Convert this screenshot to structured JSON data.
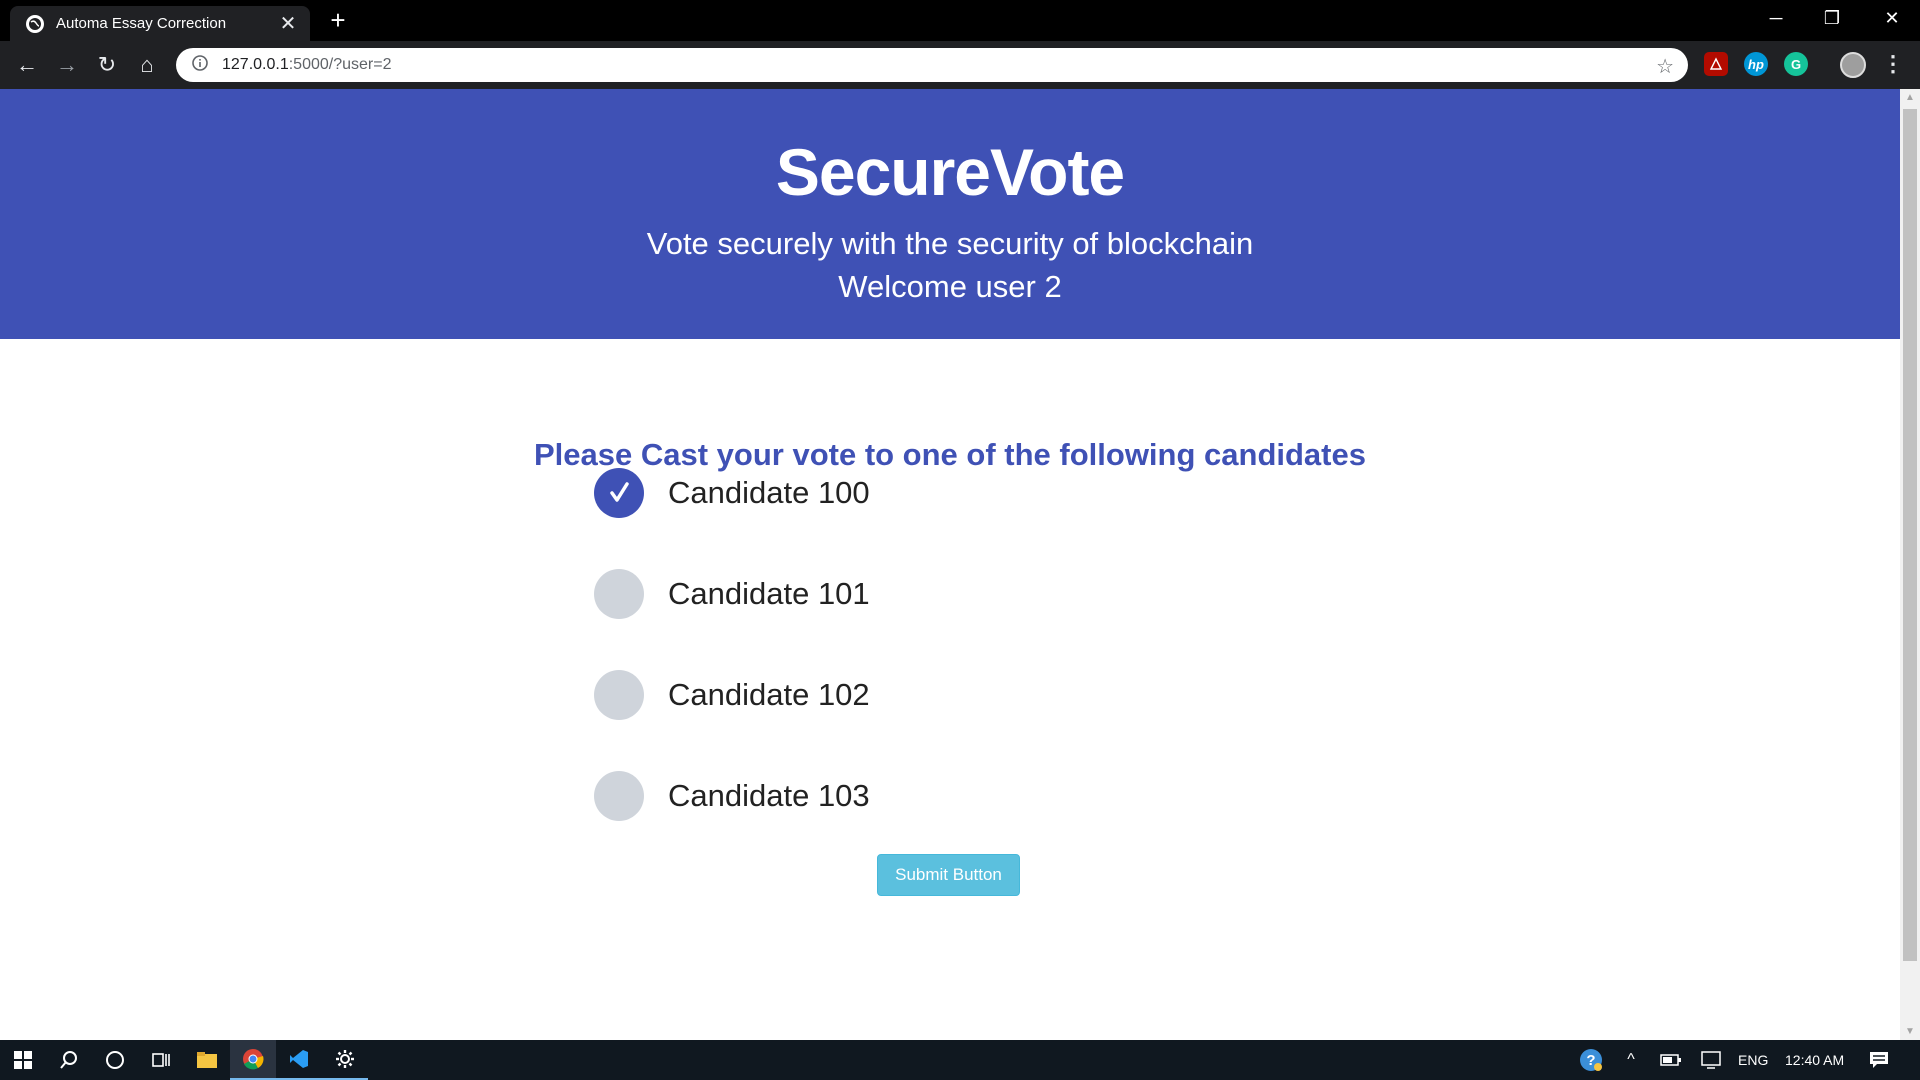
{
  "browser": {
    "tab_title": "Automa Essay Correction",
    "tab_close": "✕",
    "new_tab": "+",
    "url_host": "127.0.0.1",
    "url_rest": ":5000/?user=2",
    "window_controls": {
      "minimize": "─",
      "restore": "❐",
      "close": "✕"
    },
    "nav": {
      "back": "←",
      "forward": "→",
      "reload": "↻",
      "home": "⌂"
    },
    "extensions": [
      {
        "name": "acrobat-extension-icon",
        "color": "#b30b00"
      },
      {
        "name": "hp-extension-icon",
        "label": "hp",
        "color": "#0096d6"
      },
      {
        "name": "grammarly-extension-icon",
        "label": "G",
        "color": "#15c39a"
      }
    ]
  },
  "page": {
    "title": "SecureVote",
    "subtitle": "Vote securely with the security of blockchain",
    "welcome": "Welcome user 2",
    "prompt": "Please Cast your vote to one of the following candidates",
    "candidates": [
      {
        "label": "Candidate 100",
        "checked": true
      },
      {
        "label": "Candidate 101",
        "checked": false
      },
      {
        "label": "Candidate 102",
        "checked": false
      },
      {
        "label": "Candidate 103",
        "checked": false
      }
    ],
    "submit_label": "Submit Button",
    "accent": "#3f51b5",
    "button_color": "#5bc0de"
  },
  "taskbar": {
    "language": "ENG",
    "time": "12:40 AM"
  }
}
